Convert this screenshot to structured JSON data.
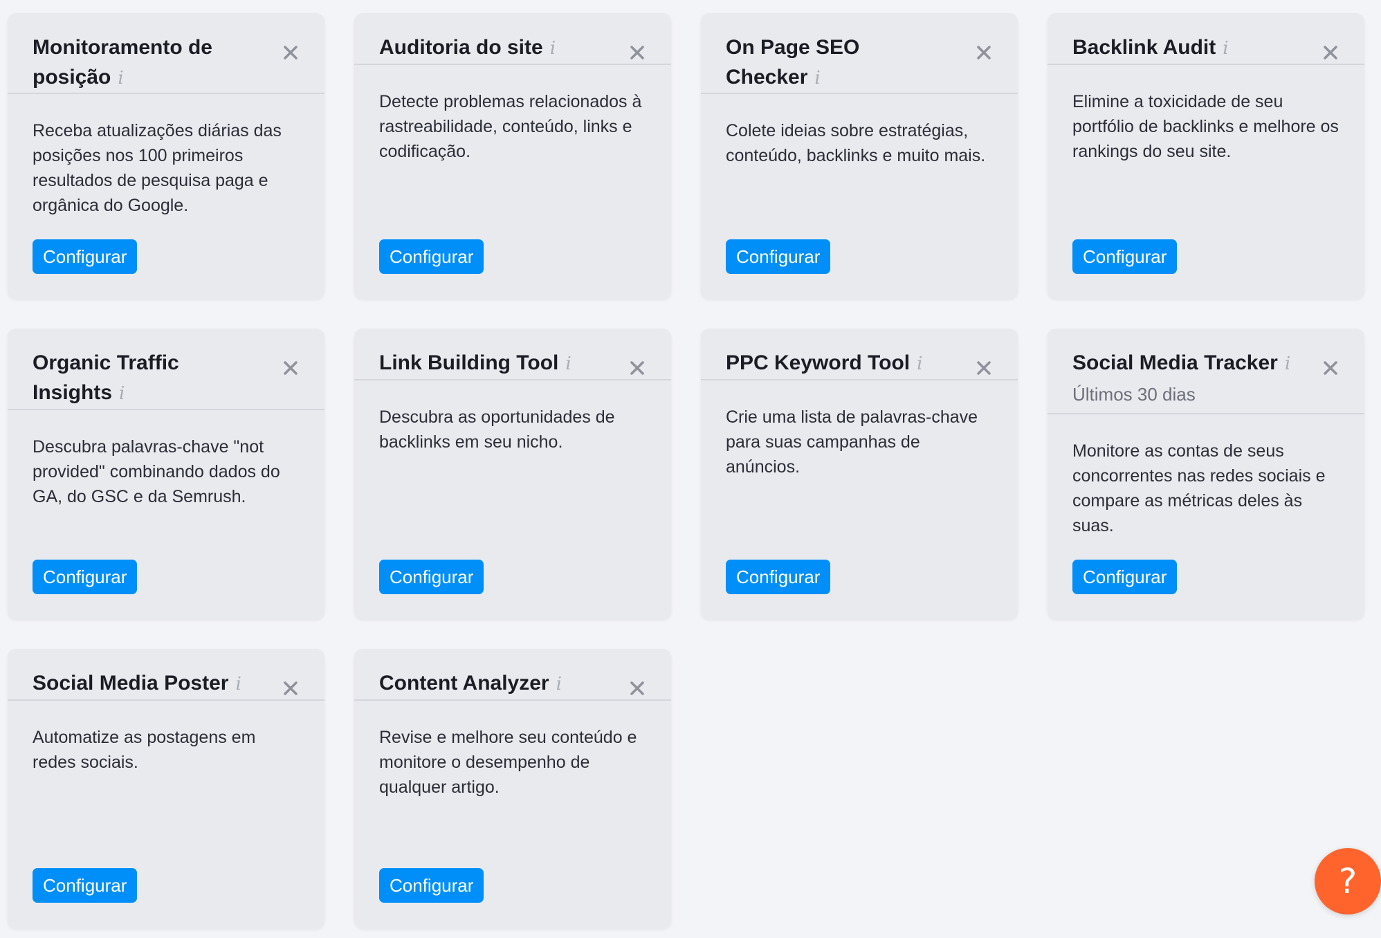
{
  "colors": {
    "page_background": "#f3f4f7",
    "card_background": "#e9eaee",
    "primary_button": "#008ff8",
    "help_button": "#ff642d"
  },
  "widgets": [
    {
      "title": "Monitoramento de posição",
      "subtitle": "",
      "description": "Receba atualizações diárias das posições nos 100 primeiros resultados de pesquisa paga e orgânica do Google.",
      "button_label": "Configurar",
      "info_icon": "info-icon",
      "close_icon": "close-icon"
    },
    {
      "title": "Auditoria do site",
      "subtitle": "",
      "description": "Detecte problemas relacionados à rastreabilidade, conteúdo, links e codificação.",
      "button_label": "Configurar",
      "info_icon": "info-icon",
      "close_icon": "close-icon"
    },
    {
      "title": "On Page SEO Checker",
      "subtitle": "",
      "description": "Colete ideias sobre estratégias, conteúdo, backlinks e muito mais.",
      "button_label": "Configurar",
      "info_icon": "info-icon",
      "close_icon": "close-icon"
    },
    {
      "title": "Backlink Audit",
      "subtitle": "",
      "description": "Elimine a toxicidade de seu portfólio de backlinks e melhore os rankings do seu site.",
      "button_label": "Configurar",
      "info_icon": "info-icon",
      "close_icon": "close-icon"
    },
    {
      "title": "Organic Traffic Insights",
      "subtitle": "",
      "description": "Descubra palavras-chave \"not provided\" combinando dados do GA, do GSC e da Semrush.",
      "button_label": "Configurar",
      "info_icon": "info-icon",
      "close_icon": "close-icon"
    },
    {
      "title": "Link Building Tool",
      "subtitle": "",
      "description": "Descubra as oportunidades de backlinks em seu nicho.",
      "button_label": "Configurar",
      "info_icon": "info-icon",
      "close_icon": "close-icon"
    },
    {
      "title": "PPC Keyword Tool",
      "subtitle": "",
      "description": "Crie uma lista de palavras-chave para suas campanhas de anúncios.",
      "button_label": "Configurar",
      "info_icon": "info-icon",
      "close_icon": "close-icon"
    },
    {
      "title": "Social Media Tracker",
      "subtitle": "Últimos 30 dias",
      "description": "Monitore as contas de seus concorrentes nas redes sociais e compare as métricas deles às suas.",
      "button_label": "Configurar",
      "info_icon": "info-icon",
      "close_icon": "close-icon"
    },
    {
      "title": "Social Media Poster",
      "subtitle": "",
      "description": "Automatize as postagens em redes sociais.",
      "button_label": "Configurar",
      "info_icon": "info-icon",
      "close_icon": "close-icon"
    },
    {
      "title": "Content Analyzer",
      "subtitle": "",
      "description": "Revise e melhore seu conteúdo e monitore o desempenho de qualquer artigo.",
      "button_label": "Configurar",
      "info_icon": "info-icon",
      "close_icon": "close-icon"
    }
  ],
  "help_button": {
    "label": "?",
    "icon": "question-mark-icon"
  }
}
